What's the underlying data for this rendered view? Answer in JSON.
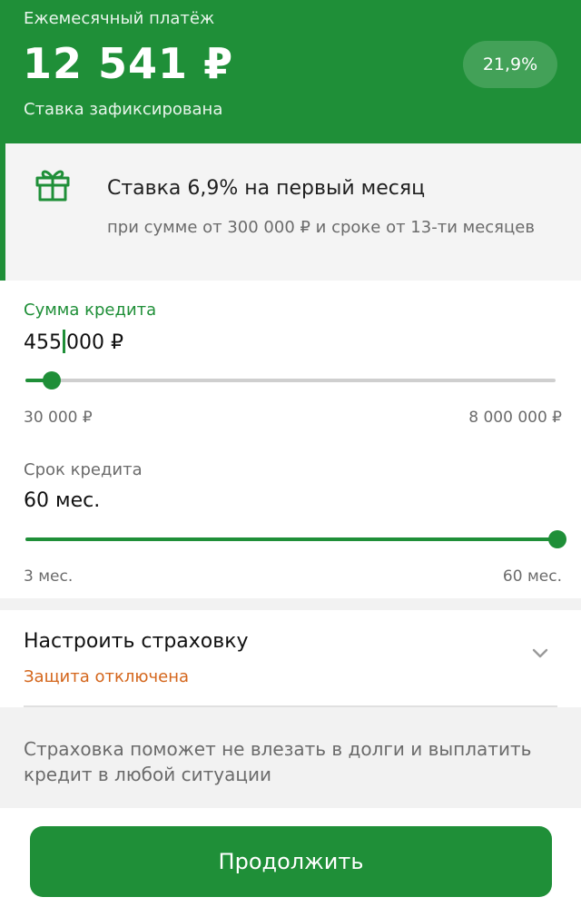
{
  "header": {
    "caption": "Ежемесячный платёж",
    "amount": "12 541 ₽",
    "status": "Ставка зафиксирована",
    "rate": "21,9%"
  },
  "promo": {
    "icon": "gift-icon",
    "title": "Ставка 6,9% на первый месяц",
    "description": "при сумме от  300 000 ₽ и сроке от 13-ти месяцев"
  },
  "loan_amount": {
    "label": "Сумма кредита",
    "value_before_caret": "455",
    "value_after_caret": "000 ₽",
    "min_label": "30 000 ₽",
    "max_label": "8 000 000 ₽",
    "slider_fraction": 0.05
  },
  "loan_term": {
    "label": "Срок кредита",
    "value": "60 мес.",
    "min_label": "3 мес.",
    "max_label": "60 мес.",
    "slider_fraction": 1.0
  },
  "insurance": {
    "title": "Настроить страховку",
    "status": "Защита отключена",
    "note": "Страховка поможет не влезать в долги и выплатить кредит в любой ситуации"
  },
  "cta": {
    "label": "Продолжить"
  },
  "colors": {
    "brand_green": "#1f8f38",
    "warning_orange": "#d4661c",
    "muted_text": "#6b6b6b"
  }
}
